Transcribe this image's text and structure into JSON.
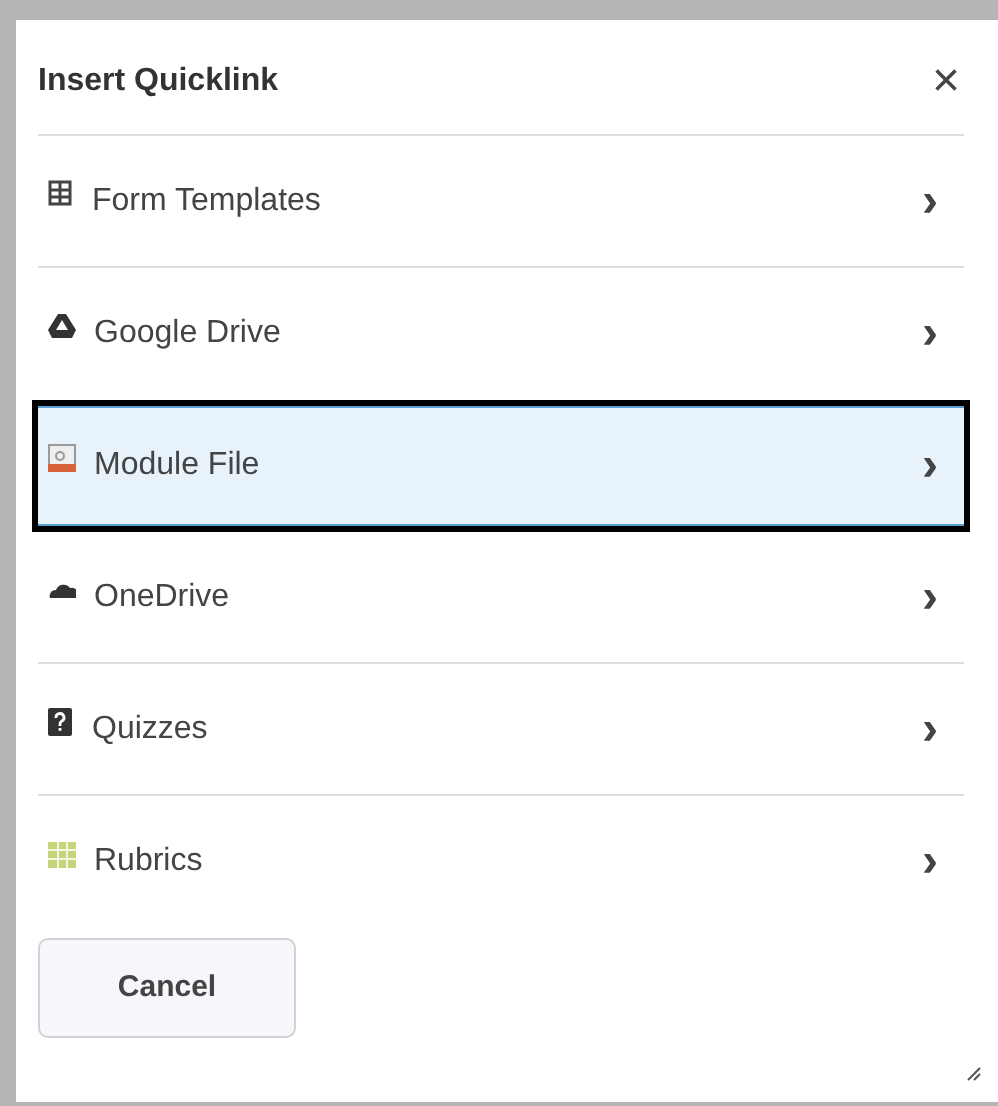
{
  "dialog": {
    "title": "Insert Quicklink",
    "close": "×"
  },
  "items": [
    {
      "label": "Form Templates",
      "kind": "form",
      "selected": false,
      "chevron": "›"
    },
    {
      "label": "Google Drive",
      "kind": "drive",
      "selected": false,
      "chevron": "›"
    },
    {
      "label": "Module File",
      "kind": "file",
      "selected": true,
      "chevron": "›"
    },
    {
      "label": "OneDrive",
      "kind": "cloud",
      "selected": false,
      "chevron": "›"
    },
    {
      "label": "Quizzes",
      "kind": "quiz",
      "selected": false,
      "chevron": "›"
    },
    {
      "label": "Rubrics",
      "kind": "rubric",
      "selected": false,
      "chevron": "›"
    }
  ],
  "buttons": [
    {
      "label": "Cancel"
    }
  ]
}
